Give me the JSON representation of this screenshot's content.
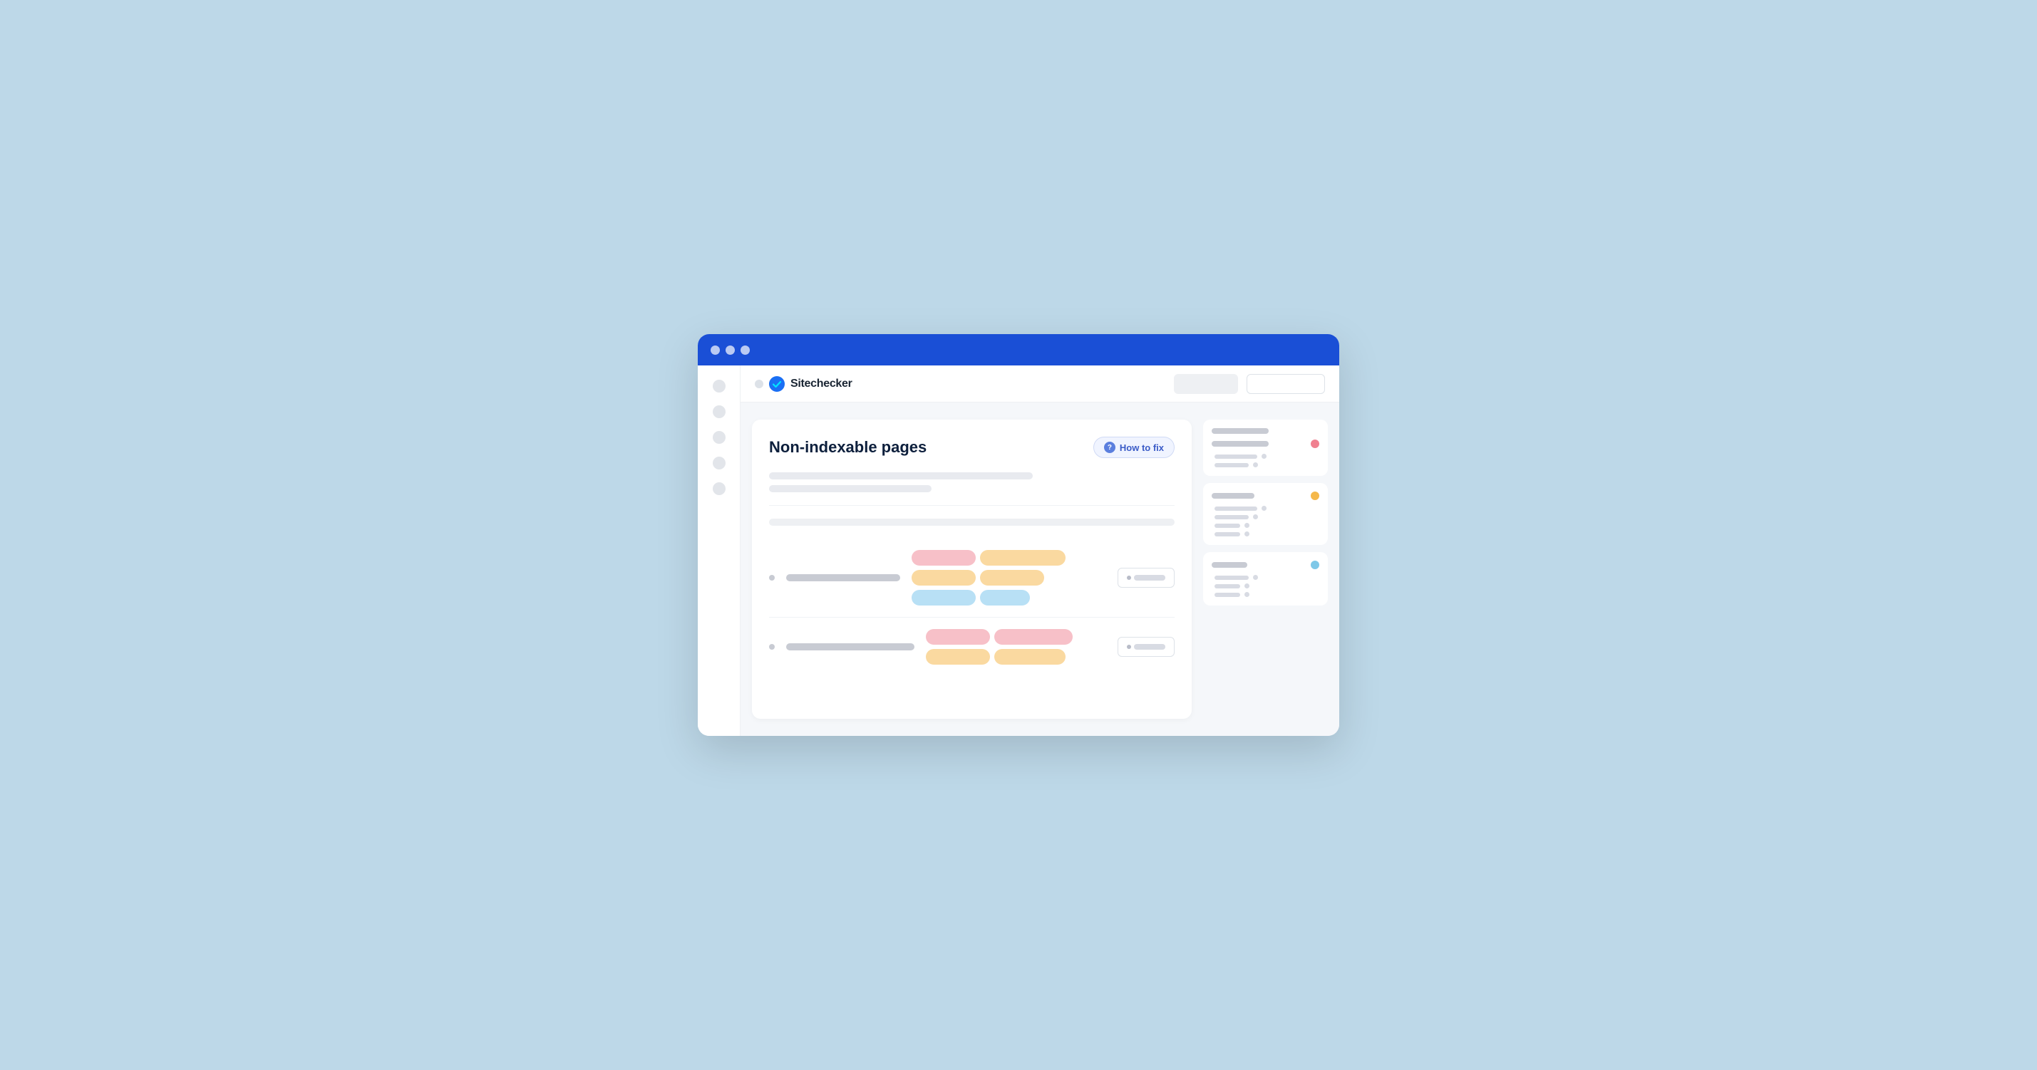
{
  "browser": {
    "title": "Sitechecker",
    "traffic_lights": [
      "",
      "",
      ""
    ]
  },
  "topbar": {
    "logo_text": "Sitechecker",
    "btn1_label": "",
    "btn2_label": ""
  },
  "card": {
    "title": "Non-indexable pages",
    "how_to_fix_label": "How to fix",
    "desc_bar1": "",
    "desc_bar2": ""
  },
  "rows": [
    {
      "tags": [
        {
          "color": "pink",
          "size": "md"
        },
        {
          "color": "orange",
          "size": "xl"
        },
        {
          "color": "orange",
          "size": "md"
        },
        {
          "color": "orange",
          "size": "md"
        },
        {
          "color": "blue",
          "size": "md"
        },
        {
          "color": "blue",
          "size": "sm"
        }
      ]
    },
    {
      "tags": [
        {
          "color": "pink",
          "size": "md"
        },
        {
          "color": "pink",
          "size": "lg"
        },
        {
          "color": "orange",
          "size": "md"
        },
        {
          "color": "orange",
          "size": "md"
        }
      ]
    }
  ],
  "right_panel": {
    "sections": [
      {
        "rows": [
          {
            "bar_size": "lg",
            "dot": "none"
          },
          {
            "bar_size": "lg",
            "dot": "red"
          },
          {
            "bar_size": "md",
            "dot": "none"
          },
          {
            "bar_size": "md",
            "dot": "none"
          }
        ]
      },
      {
        "rows": [
          {
            "bar_size": "lg",
            "dot": "orange"
          },
          {
            "bar_size": "md",
            "dot": "none"
          },
          {
            "bar_size": "md",
            "dot": "none"
          },
          {
            "bar_size": "sm",
            "dot": "none"
          },
          {
            "bar_size": "xs",
            "dot": "none"
          }
        ]
      },
      {
        "rows": [
          {
            "bar_size": "md",
            "dot": "blue"
          },
          {
            "bar_size": "sm",
            "dot": "mini"
          },
          {
            "bar_size": "xs",
            "dot": "mini"
          },
          {
            "bar_size": "xs",
            "dot": "mini"
          }
        ]
      }
    ]
  },
  "icons": {
    "check_mark": "✓",
    "question_mark": "?"
  }
}
